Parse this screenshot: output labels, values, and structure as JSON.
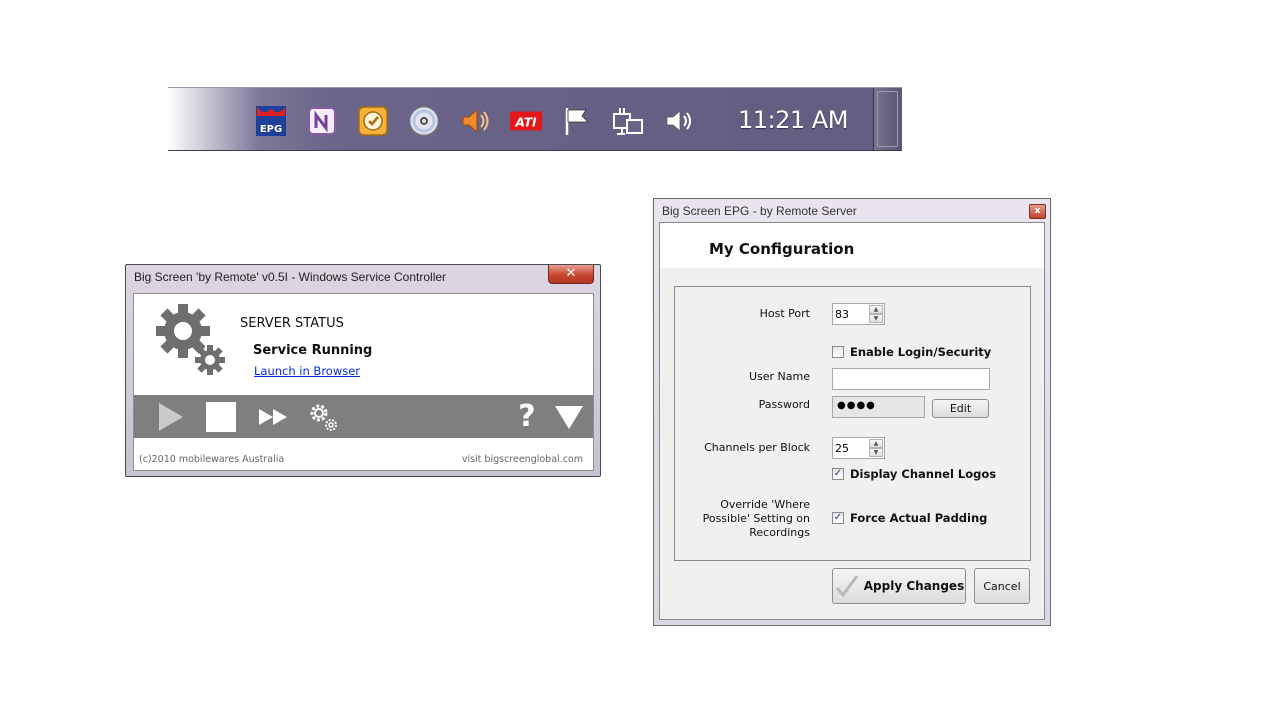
{
  "tray": {
    "icons": [
      "epg-icon",
      "onenote-icon",
      "outlook-reminder-icon",
      "cd-drive-icon",
      "volume-muted-icon",
      "ati-icon",
      "action-center-flag-icon",
      "network-icon",
      "volume-icon"
    ],
    "epg_label": "EPG",
    "ati_label": "ATI",
    "clock": "11:21 AM"
  },
  "service_controller": {
    "title": "Big Screen 'by Remote' v0.5I - Windows Service Controller",
    "close_label": "✕",
    "status_heading": "SERVER STATUS",
    "status_value": "Service Running",
    "launch_link": "Launch in Browser",
    "toolbar": [
      "play-icon",
      "stop-icon",
      "fast-forward-icon",
      "settings-gears-icon",
      "help-icon",
      "collapse-arrow-icon"
    ],
    "help_glyph": "?",
    "footer_left": "(c)2010 mobilewares Australia",
    "footer_right": "visit bigscreenglobal.com"
  },
  "config": {
    "title": "Big Screen EPG - by Remote Server",
    "close_label": "x",
    "heading": "My Configuration",
    "host_port_label": "Host Port",
    "host_port_value": "83",
    "enable_login_label": "Enable Login/Security",
    "enable_login_checked": false,
    "username_label": "User Name",
    "username_value": "",
    "password_label": "Password",
    "password_value": "●●●●",
    "edit_label": "Edit",
    "channels_label": "Channels per Block",
    "channels_value": "25",
    "display_logos_label": "Display Channel Logos",
    "display_logos_checked": true,
    "override_label_1": "Override 'Where",
    "override_label_2": "Possible' Setting on",
    "override_label_3": "Recordings",
    "force_padding_label": "Force Actual Padding",
    "force_padding_checked": true,
    "apply_label": "Apply Changes",
    "cancel_label": "Cancel",
    "check_glyph": "✓"
  }
}
